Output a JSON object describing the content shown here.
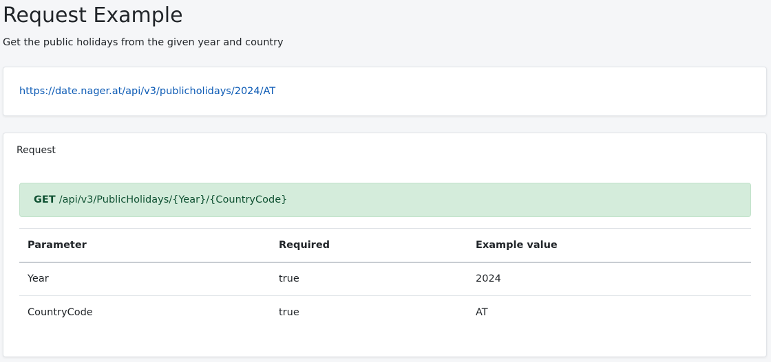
{
  "header": {
    "title": "Request Example",
    "subtitle": "Get the public holidays from the given year and country"
  },
  "url_card": {
    "url": "https://date.nager.at/api/v3/publicholidays/2024/AT"
  },
  "request": {
    "heading": "Request",
    "method": "GET",
    "path": "/api/v3/PublicHolidays/{Year}/{CountryCode}",
    "columns": [
      "Parameter",
      "Required",
      "Example value"
    ],
    "rows": [
      [
        "Year",
        "true",
        "2024"
      ],
      [
        "CountryCode",
        "true",
        "AT"
      ]
    ]
  },
  "colors": {
    "link": "#0d5bb5",
    "endpoint_bg": "#d4ecdb",
    "endpoint_text": "#0f5132"
  }
}
